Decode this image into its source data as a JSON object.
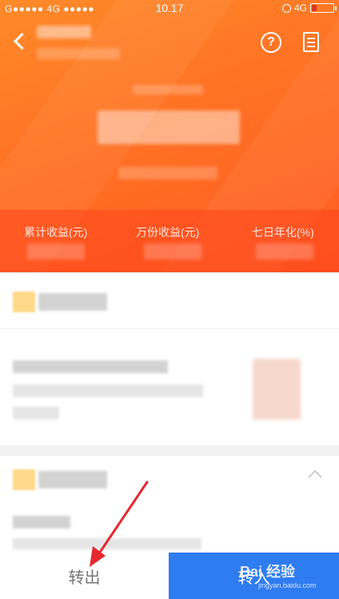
{
  "status_bar": {
    "carrier": "G●●●●● 4G ●●●●●",
    "time": "10.17",
    "network": "4G"
  },
  "header": {
    "back_icon": "chevron-left-icon",
    "help_icon": "question-circle-icon",
    "help_glyph": "?",
    "doc_icon": "document-icon"
  },
  "stats": {
    "cumulative_label": "累计收益(元)",
    "per10k_label": "万份收益(元)",
    "seven_day_label": "七日年化(%)"
  },
  "actions": {
    "transfer_out": "转出",
    "transfer_in": "转入"
  },
  "watermark": {
    "text": "Bai 经验",
    "sub": "jingyan.baidu.com"
  },
  "colors": {
    "header_orange": "#ff7424",
    "action_blue": "#2f7bf0",
    "arrow_red": "#e8272f"
  }
}
